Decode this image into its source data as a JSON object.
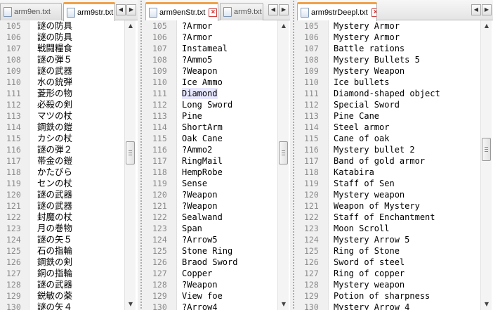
{
  "icons": {
    "file": "file-icon",
    "close": "close-icon",
    "left": "left-arrow-icon",
    "right": "right-arrow-icon"
  },
  "colors": {
    "active_tab_accent": "#f0a14a",
    "highlight": "#e8e8ff",
    "close": "#cc2222"
  },
  "glyphs": {
    "close": "×",
    "left": "◀",
    "right": "▶",
    "up": "▲",
    "down": "▼"
  },
  "panes": [
    {
      "tabs": [
        {
          "label": "arm9en.txt",
          "active": false
        },
        {
          "label": "arm9str.txt",
          "active": true
        }
      ],
      "lines": [
        {
          "n": "105",
          "t": "謎の防具"
        },
        {
          "n": "106",
          "t": "謎の防具"
        },
        {
          "n": "107",
          "t": "戦闘糧食"
        },
        {
          "n": "108",
          "t": "謎の弾５"
        },
        {
          "n": "109",
          "t": "謎の武器"
        },
        {
          "n": "110",
          "t": "水の銃弾"
        },
        {
          "n": "111",
          "t": "菱形の物"
        },
        {
          "n": "112",
          "t": "必殺の剣"
        },
        {
          "n": "113",
          "t": "マツの杖"
        },
        {
          "n": "114",
          "t": "鋼鉄の鎧"
        },
        {
          "n": "115",
          "t": "カシの杖"
        },
        {
          "n": "116",
          "t": "謎の弾２"
        },
        {
          "n": "117",
          "t": "帯金の鎧"
        },
        {
          "n": "118",
          "t": "かたびら"
        },
        {
          "n": "119",
          "t": "センの杖"
        },
        {
          "n": "120",
          "t": "謎の武器"
        },
        {
          "n": "121",
          "t": "謎の武器"
        },
        {
          "n": "122",
          "t": "封魔の杖"
        },
        {
          "n": "123",
          "t": "月の巻物"
        },
        {
          "n": "124",
          "t": "謎の矢５"
        },
        {
          "n": "125",
          "t": "石の指輪"
        },
        {
          "n": "126",
          "t": "鋼鉄の剣"
        },
        {
          "n": "127",
          "t": "銅の指輪"
        },
        {
          "n": "128",
          "t": "謎の武器"
        },
        {
          "n": "129",
          "t": "鋭敏の薬"
        },
        {
          "n": "130",
          "t": "謎の矢４"
        }
      ]
    },
    {
      "tabs": [
        {
          "label": "arm9enStr.txt",
          "active": true
        },
        {
          "label": "arm9.txt",
          "active": false
        }
      ],
      "lines": [
        {
          "n": "105",
          "t": "?Armor"
        },
        {
          "n": "106",
          "t": "?Armor"
        },
        {
          "n": "107",
          "t": "Instameal"
        },
        {
          "n": "108",
          "t": "?Ammo5"
        },
        {
          "n": "109",
          "t": "?Weapon"
        },
        {
          "n": "110",
          "t": "Ice Ammo"
        },
        {
          "n": "111",
          "t": "Diamond"
        },
        {
          "n": "112",
          "t": "Long Sword"
        },
        {
          "n": "113",
          "t": "Pine"
        },
        {
          "n": "114",
          "t": "ShortArm"
        },
        {
          "n": "115",
          "t": "Oak Cane"
        },
        {
          "n": "116",
          "t": "?Ammo2"
        },
        {
          "n": "117",
          "t": "RingMail"
        },
        {
          "n": "118",
          "t": "HempRobe"
        },
        {
          "n": "119",
          "t": "Sense"
        },
        {
          "n": "120",
          "t": "?Weapon"
        },
        {
          "n": "121",
          "t": "?Weapon"
        },
        {
          "n": "122",
          "t": "Sealwand"
        },
        {
          "n": "123",
          "t": "Span"
        },
        {
          "n": "124",
          "t": "?Arrow5"
        },
        {
          "n": "125",
          "t": "Stone Ring"
        },
        {
          "n": "126",
          "t": "Braod Sword"
        },
        {
          "n": "127",
          "t": "Copper"
        },
        {
          "n": "128",
          "t": "?Weapon"
        },
        {
          "n": "129",
          "t": "View foe"
        },
        {
          "n": "130",
          "t": "?Arrow4"
        }
      ]
    },
    {
      "tabs": [
        {
          "label": "arm9strDeepl.txt",
          "active": true
        }
      ],
      "lines": [
        {
          "n": "105",
          "t": "Mystery Armor"
        },
        {
          "n": "106",
          "t": "Mystery Armor"
        },
        {
          "n": "107",
          "t": "Battle rations"
        },
        {
          "n": "108",
          "t": "Mystery Bullets 5"
        },
        {
          "n": "109",
          "t": "Mystery Weapon"
        },
        {
          "n": "110",
          "t": "Ice bullets"
        },
        {
          "n": "111",
          "t": "Diamond-shaped object"
        },
        {
          "n": "112",
          "t": "Special Sword"
        },
        {
          "n": "113",
          "t": "Pine Cane"
        },
        {
          "n": "114",
          "t": "Steel armor"
        },
        {
          "n": "115",
          "t": "Cane of oak"
        },
        {
          "n": "116",
          "t": "Mystery bullet 2"
        },
        {
          "n": "117",
          "t": "Band of gold armor"
        },
        {
          "n": "118",
          "t": "Katabira"
        },
        {
          "n": "119",
          "t": "Staff of Sen"
        },
        {
          "n": "120",
          "t": "Mystery weapon"
        },
        {
          "n": "121",
          "t": "Weapon of Mystery"
        },
        {
          "n": "122",
          "t": "Staff of Enchantment"
        },
        {
          "n": "123",
          "t": "Moon Scroll"
        },
        {
          "n": "124",
          "t": "Mystery Arrow 5"
        },
        {
          "n": "125",
          "t": "Ring of Stone"
        },
        {
          "n": "126",
          "t": "Sword of steel"
        },
        {
          "n": "127",
          "t": "Ring of copper"
        },
        {
          "n": "128",
          "t": "Mystery weapon"
        },
        {
          "n": "129",
          "t": "Potion of sharpness"
        },
        {
          "n": "130",
          "t": "Mystery Arrow 4"
        }
      ]
    }
  ]
}
